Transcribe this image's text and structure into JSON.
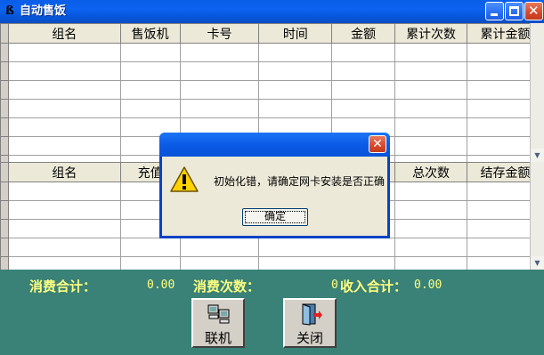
{
  "window": {
    "app_icon": "ß",
    "title": "自动售饭"
  },
  "top_grid": {
    "columns": [
      "组名",
      "售饭机",
      "卡号",
      "时间",
      "金额",
      "累计次数",
      "累计金额"
    ]
  },
  "bottom_grid": {
    "columns": [
      "组名",
      "充值",
      "",
      "",
      "总次数",
      "结存金额"
    ]
  },
  "summary": {
    "consume_total_label": "消费合计：",
    "consume_total_value": "0.00",
    "consume_count_label": "消费次数：",
    "consume_count_value": "0",
    "income_total_label": "收入合计：",
    "income_total_value": "0.00"
  },
  "buttons": {
    "connect_label": "联机",
    "close_label": "关闭"
  },
  "dialog": {
    "message": "初始化错，请确定网卡安装是否正确",
    "ok_label": "确定",
    "close_glyph": "✕"
  },
  "colors": {
    "titlebar": "#0a5ee8",
    "panel": "#3a8277",
    "summary_text": "#ffff80"
  },
  "icons": {
    "window": "app-logo-icon",
    "warning": "warning-icon",
    "connect": "network-computers-icon",
    "close": "exit-door-icon"
  }
}
